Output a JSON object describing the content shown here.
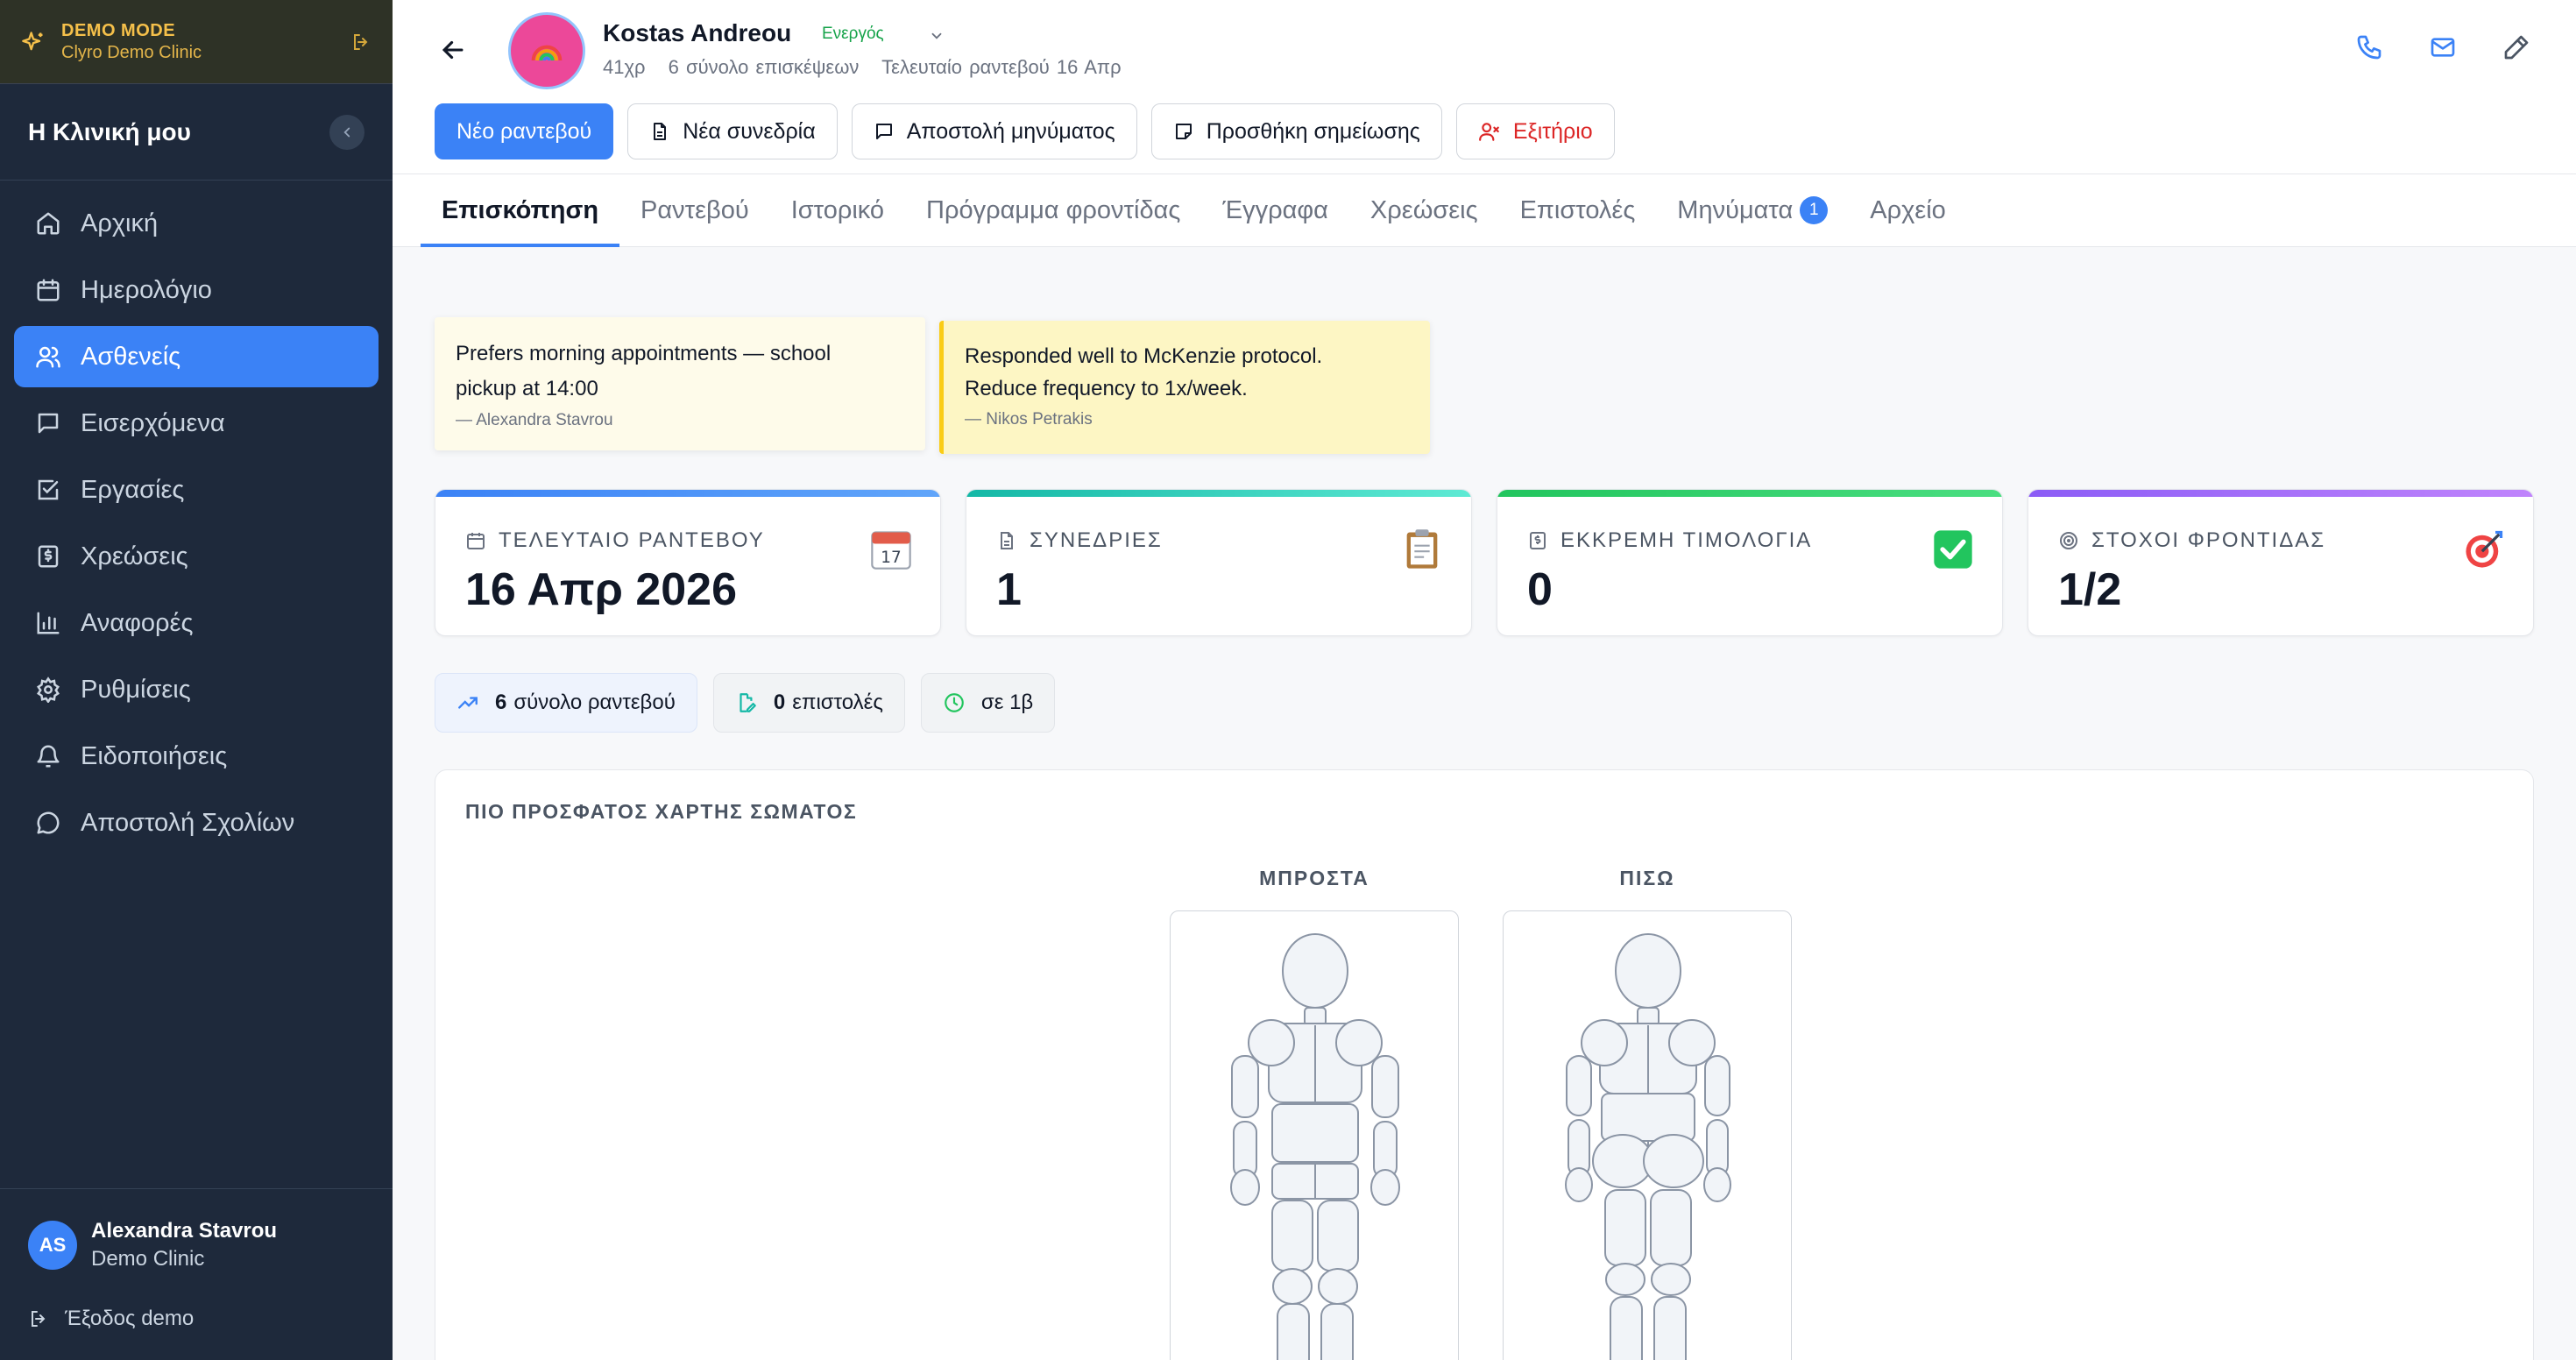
{
  "demo": {
    "label": "DEMO MODE",
    "clinic": "Clyro Demo Clinic"
  },
  "sidebar": {
    "title": "Η Κλινική μου",
    "items": [
      {
        "label": "Αρχική",
        "icon": "home-icon"
      },
      {
        "label": "Ημερολόγιο",
        "icon": "calendar-icon"
      },
      {
        "label": "Ασθενείς",
        "icon": "users-icon",
        "active": true
      },
      {
        "label": "Εισερχόμενα",
        "icon": "message-square-icon"
      },
      {
        "label": "Εργασίες",
        "icon": "check-square-icon"
      },
      {
        "label": "Χρεώσεις",
        "icon": "receipt-icon"
      },
      {
        "label": "Αναφορές",
        "icon": "bar-chart-icon"
      },
      {
        "label": "Ρυθμίσεις",
        "icon": "gear-icon"
      },
      {
        "label": "Ειδοποιήσεις",
        "icon": "bell-icon"
      },
      {
        "label": "Αποστολή Σχολίων",
        "icon": "message-circle-icon"
      }
    ],
    "user": {
      "initials": "AS",
      "name": "Alexandra Stavrou",
      "clinic": "Demo Clinic"
    },
    "exit_label": "Έξοδος demo"
  },
  "patient": {
    "name": "Kostas Andreou",
    "status": "Ενεργός",
    "age": "41χρ",
    "total_visits": "6 σύνολο επισκέψεων",
    "last_appointment": "Τελευταίο ραντεβού 16 Απρ",
    "avatar_emoji": "🌈"
  },
  "actions": {
    "new_appointment": "Νέο ραντεβού",
    "new_session": "Νέα συνεδρία",
    "send_message": "Αποστολή μηνύματος",
    "add_note": "Προσθήκη σημείωσης",
    "discharge": "Εξιτήριο"
  },
  "tabs": [
    {
      "label": "Επισκόπηση",
      "active": true
    },
    {
      "label": "Ραντεβού"
    },
    {
      "label": "Ιστορικό"
    },
    {
      "label": "Πρόγραμμα φροντίδας"
    },
    {
      "label": "Έγγραφα"
    },
    {
      "label": "Χρεώσεις"
    },
    {
      "label": "Επιστολές"
    },
    {
      "label": "Μηνύματα",
      "badge": "1"
    },
    {
      "label": "Αρχείο"
    }
  ],
  "notes": [
    {
      "line1": "Prefers morning appointments — school",
      "line2": "pickup at 14:00",
      "author": "— Alexandra Stavrou"
    },
    {
      "line1": "Responded well to McKenzie protocol.",
      "line2": "Reduce frequency to 1x/week.",
      "author": "— Nikos Petrakis"
    }
  ],
  "stats": [
    {
      "label": "ΤΕΛΕΥΤΑΙΟ ΡΑΝΤΕΒΟΥ",
      "value": "16 Απρ 2026",
      "icon": "calendar-icon",
      "emoji": "calendar-17-emoji",
      "color": "#3b82f6"
    },
    {
      "label": "ΣΥΝΕΔΡΙΕΣ",
      "value": "1",
      "icon": "file-icon",
      "emoji": "clipboard-emoji",
      "color": "#14b8a6"
    },
    {
      "label": "ΕΚΚΡΕΜΗ ΤΙΜΟΛΟΓΙΑ",
      "value": "0",
      "icon": "receipt-icon",
      "emoji": "check-mark-emoji",
      "color": "#22c55e"
    },
    {
      "label": "ΣΤΟΧΟΙ ΦΡΟΝΤΙΔΑΣ",
      "value": "1/2",
      "icon": "target-icon",
      "emoji": "dart-emoji",
      "color": "#8b5cf6"
    }
  ],
  "pills": [
    {
      "bold": "6",
      "text": "σύνολο ραντεβού",
      "icon": "trending-up-icon"
    },
    {
      "bold": "0",
      "text": "επιστολές",
      "icon": "file-edit-icon"
    },
    {
      "bold": "",
      "text": "σε 1β",
      "icon": "clock-icon"
    }
  ],
  "body_map": {
    "title": "ΠΙΟ ΠΡΟΣΦΑΤΟΣ ΧΑΡΤΗΣ ΣΩΜΑΤΟΣ",
    "front_label": "ΜΠΡΟΣΤΑ",
    "back_label": "ΠΙΣΩ"
  },
  "colors": {
    "accent": "#3b82f6",
    "sidebar": "#1e293b",
    "success": "#16a34a",
    "danger": "#dc2626"
  }
}
